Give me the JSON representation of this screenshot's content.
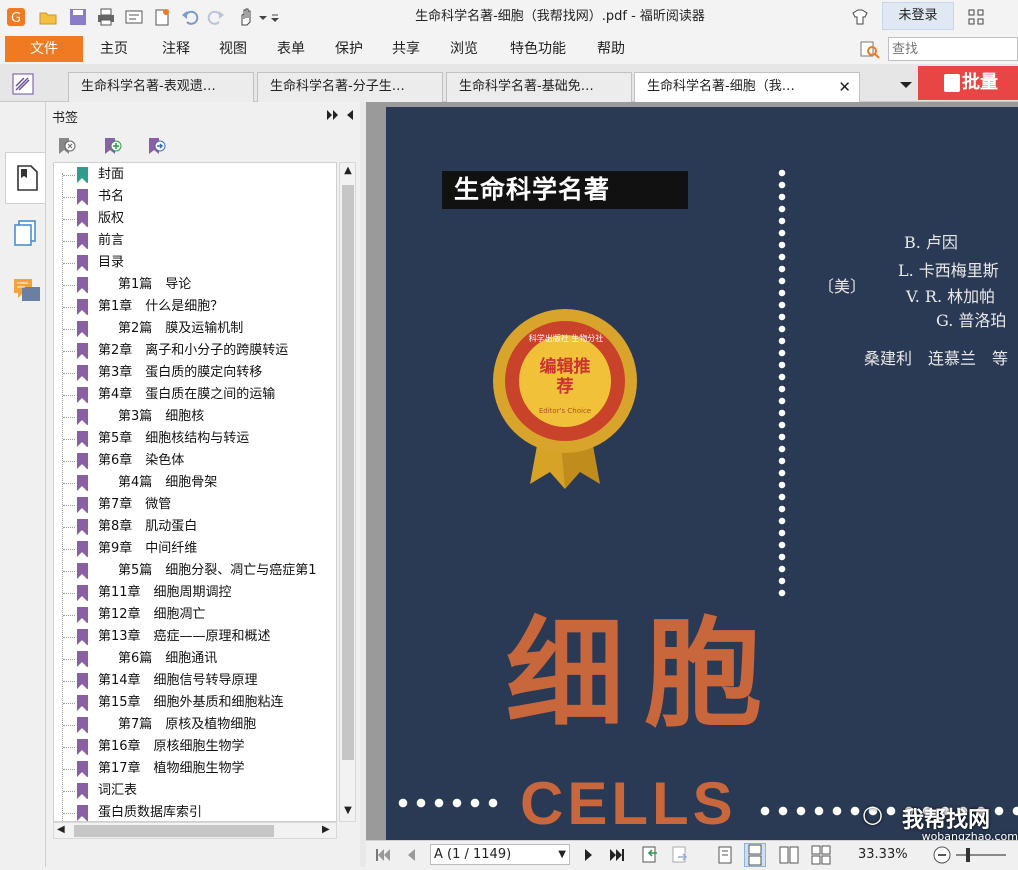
{
  "window": {
    "title": "生命科学名著-细胞（我帮找网）.pdf - 福昕阅读器",
    "login_label": "未登录"
  },
  "menu": {
    "file_label": "文件",
    "items": [
      "主页",
      "注释",
      "视图",
      "表单",
      "保护",
      "共享",
      "浏览",
      "特色功能",
      "帮助"
    ],
    "search_placeholder": "查找"
  },
  "tabs": [
    {
      "label": "生命科学名著-表观遗…"
    },
    {
      "label": "生命科学名著-分子生…"
    },
    {
      "label": "生命科学名著-基础免…"
    },
    {
      "label": "生命科学名著-细胞（我…",
      "active": true
    }
  ],
  "batch_label": "批量",
  "bookmarks": {
    "header": "书签",
    "items": [
      "封面",
      "书名",
      "版权",
      "前言",
      "目录",
      "第1篇　导论",
      "第1章　什么是细胞？",
      "第2篇　膜及运输机制",
      "第2章　离子和小分子的跨膜转运",
      "第3章　蛋白质的膜定向转移",
      "第4章　蛋白质在膜之间的运输",
      "第3篇　细胞核",
      "第5章　细胞核结构与转运",
      "第6章　染色体",
      "第4篇　细胞骨架",
      "第7章　微管",
      "第8章　肌动蛋白",
      "第9章　中间纤维",
      "第5篇　细胞分裂、凋亡与癌症第1",
      "第11章　细胞周期调控",
      "第12章　细胞凋亡",
      "第13章　癌症——原理和概述",
      "第6篇　细胞通讯",
      "第14章　细胞信号转导原理",
      "第15章　细胞外基质和细胞粘连",
      "第7篇　原核及植物细胞",
      "第16章　原核细胞生物学",
      "第17章　植物细胞生物学",
      "词汇表",
      "蛋白质数据库索引"
    ]
  },
  "cover": {
    "series": "生命科学名著",
    "authors": [
      "B. 卢因",
      "L. 卡西梅里斯",
      "V. R. 林加帕",
      "G. 普洛珀"
    ],
    "country": "〔美〕",
    "translators": "桑建利　连慕兰　等",
    "badge_main": "编辑推荐",
    "badge_sub": "Editor's Choice",
    "badge_top": "科学出版社 生物分社",
    "title_cn": "细胞",
    "title_en": "CELLS"
  },
  "status": {
    "page_value": "A (1 / 1149)",
    "zoom": "33.33%"
  },
  "watermark": {
    "text": "我帮找网",
    "url": "wobangzhao.com"
  },
  "colors": {
    "accent": "#f07a22",
    "cover_bg": "#2a3a55",
    "title_cn": "#c8663c",
    "bookmark_flag": "#8a5fa4"
  }
}
